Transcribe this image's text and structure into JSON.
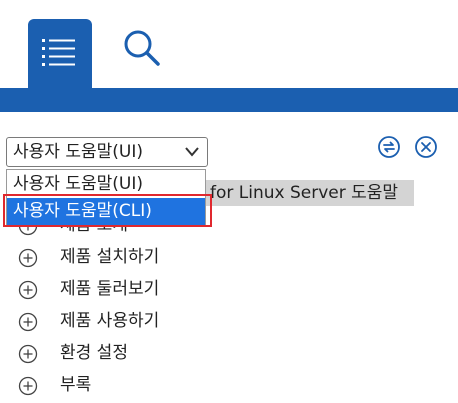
{
  "tabs": {
    "contents_icon": "list-icon",
    "search_icon": "search-icon"
  },
  "colors": {
    "accent": "#1b5fb0",
    "selected_option": "#1f73e0",
    "highlight": "#e0282e"
  },
  "help_select": {
    "value": "사용자 도움말(UI)",
    "options": [
      "사용자 도움말(UI)",
      "사용자 도움말(CLI)"
    ],
    "highlighted_option": "사용자 도움말(CLI)"
  },
  "toolbar": {
    "sync_icon": "sync-icon",
    "close_icon": "close-icon"
  },
  "document": {
    "title": "for Linux Server 도움말"
  },
  "tree": {
    "items": [
      {
        "label": "제품 소개"
      },
      {
        "label": "제품 설치하기"
      },
      {
        "label": "제품 둘러보기"
      },
      {
        "label": "제품 사용하기"
      },
      {
        "label": "환경 설정"
      },
      {
        "label": "부록"
      }
    ]
  }
}
